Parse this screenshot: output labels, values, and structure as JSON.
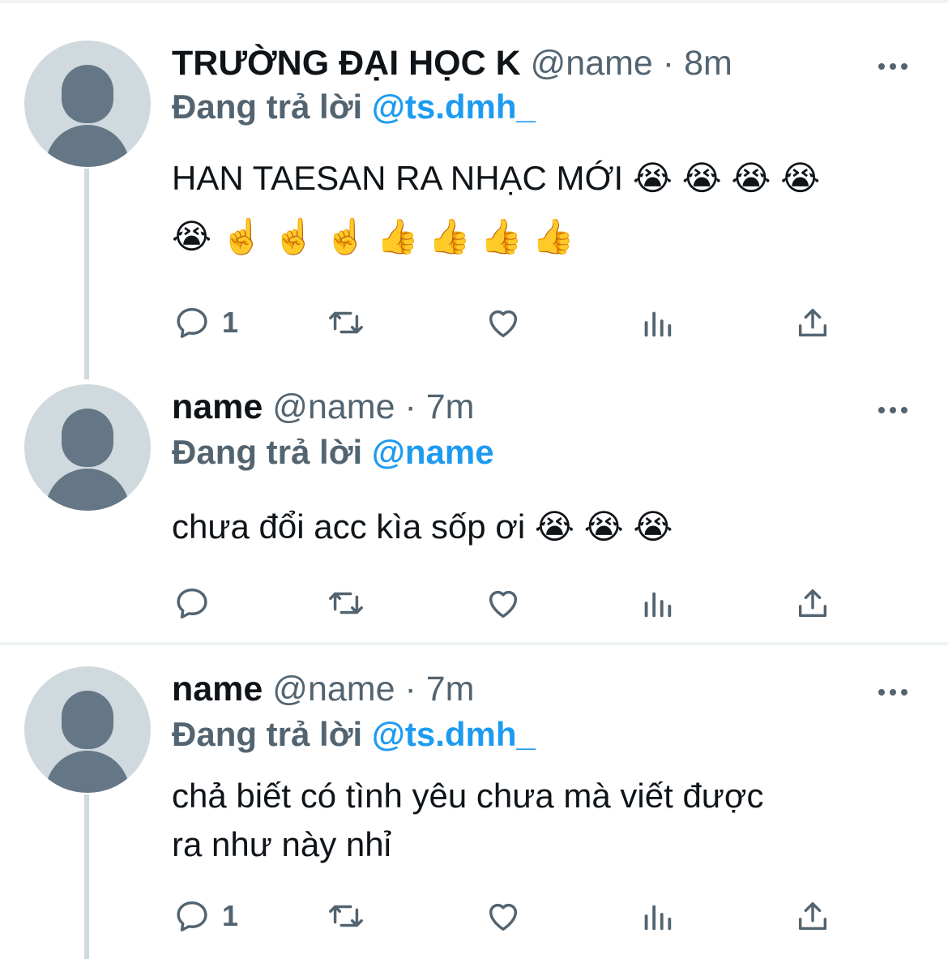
{
  "tweets": [
    {
      "display_name": "TRƯỜNG ĐẠI HỌC K",
      "handle": "@name",
      "dot": "·",
      "time": "8m",
      "reply_prefix": "Đang trả lời",
      "reply_to": "@ts.dmh_",
      "body_lines": [
        "HAN TAESAN RA NHẠC MỚI 😭 😭 😭 😭",
        "😭 ☝️ ☝️ ☝️ 👍 👍 👍 👍"
      ],
      "reply_count": "1"
    },
    {
      "display_name": "name",
      "handle": "@name",
      "dot": "·",
      "time": "7m",
      "reply_prefix": "Đang trả lời",
      "reply_to": "@name",
      "body_lines": [
        "chưa đổi acc kìa sốp ơi 😭 😭 😭"
      ],
      "reply_count": ""
    },
    {
      "display_name": "name",
      "handle": "@name",
      "dot": "·",
      "time": "7m",
      "reply_prefix": "Đang trả lời",
      "reply_to": "@ts.dmh_",
      "body_lines": [
        "chả biết có tình yêu chưa mà viết được",
        "ra như này nhỉ"
      ],
      "reply_count": "1"
    }
  ],
  "icons": {
    "reply": "speech-bubble-icon",
    "retweet": "retweet-icon",
    "like": "heart-icon",
    "views": "bar-chart-icon",
    "share": "share-upload-icon",
    "more": "more-horizontal-icon"
  },
  "colors": {
    "text_primary": "#0f1419",
    "text_secondary": "#536471",
    "mention": "#1d9bf0",
    "avatar_bg": "#cfd9de",
    "avatar_fg": "#657786"
  }
}
